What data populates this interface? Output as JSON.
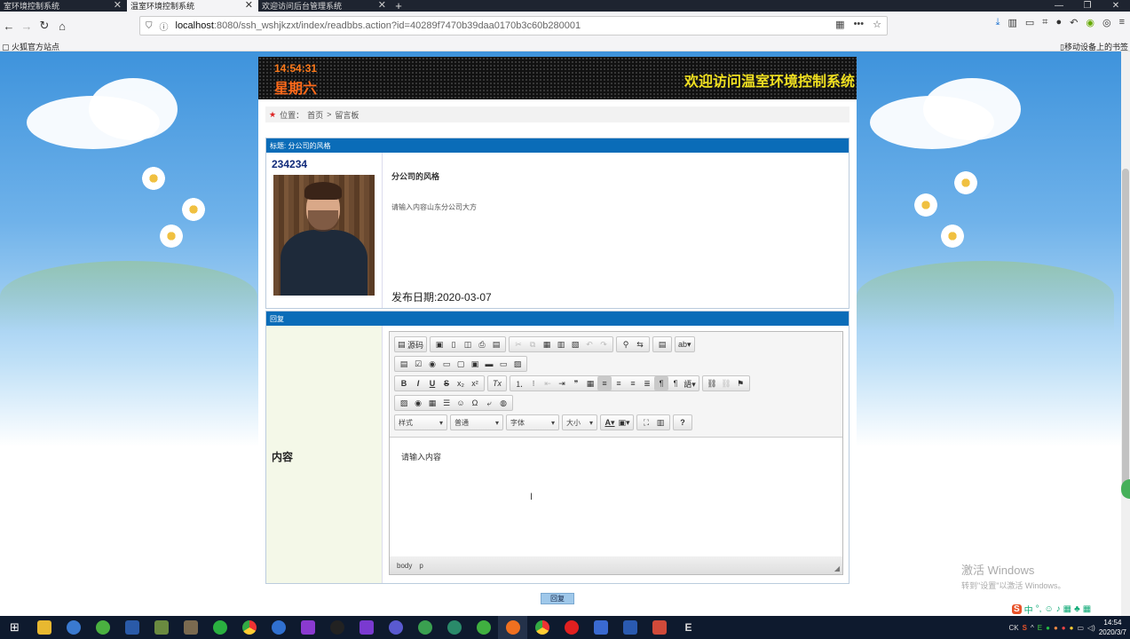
{
  "browser": {
    "tabs": [
      {
        "title": "室环境控制系统"
      },
      {
        "title": "温室环境控制系统"
      },
      {
        "title": "欢迎访问后台管理系统"
      }
    ],
    "close_glyph": "✕",
    "new_tab_glyph": "+",
    "url_host": "localhost",
    "url_path": ":8080/ssh_wshjkzxt/index/readbbs.action?id=40289f7470b39daa0170b3c60b280001",
    "bookmark": "火狐官方站点",
    "mobile_bookmarks": "移动设备上的书签"
  },
  "banner": {
    "time": "14:54:31",
    "weekday": "星期六",
    "marquee": "欢迎访问温室环境控制系统"
  },
  "breadcrumb": {
    "prefix": "位置：",
    "home": "首页",
    "sep": ">",
    "current": "留言板"
  },
  "post": {
    "header": "标题: 分公司的风格",
    "username": "234234",
    "subject": "分公司的风格",
    "content": "请输入内容山东分公司大方",
    "date": "发布日期:2020-03-07"
  },
  "reply": {
    "header": "回复",
    "label": "内容",
    "source_label": "源码",
    "combos": {
      "style": "样式",
      "format": "普通",
      "font": "字体",
      "size": "大小"
    },
    "editor_text": "请输入内容",
    "path_body": "body",
    "path_p": "p",
    "submit": "回复"
  },
  "watermark": {
    "line1": "激活 Windows",
    "line2": "转到\"设置\"以激活 Windows。"
  },
  "ime": {
    "label": "中"
  },
  "taskbar": {
    "tray_lang": "CK",
    "time": "14:54",
    "date": "2020/3/7"
  },
  "colors": {
    "header_blue": "#0a6cb8",
    "marquee_yellow": "#f0e020",
    "clock_orange": "#ff7a1a"
  }
}
